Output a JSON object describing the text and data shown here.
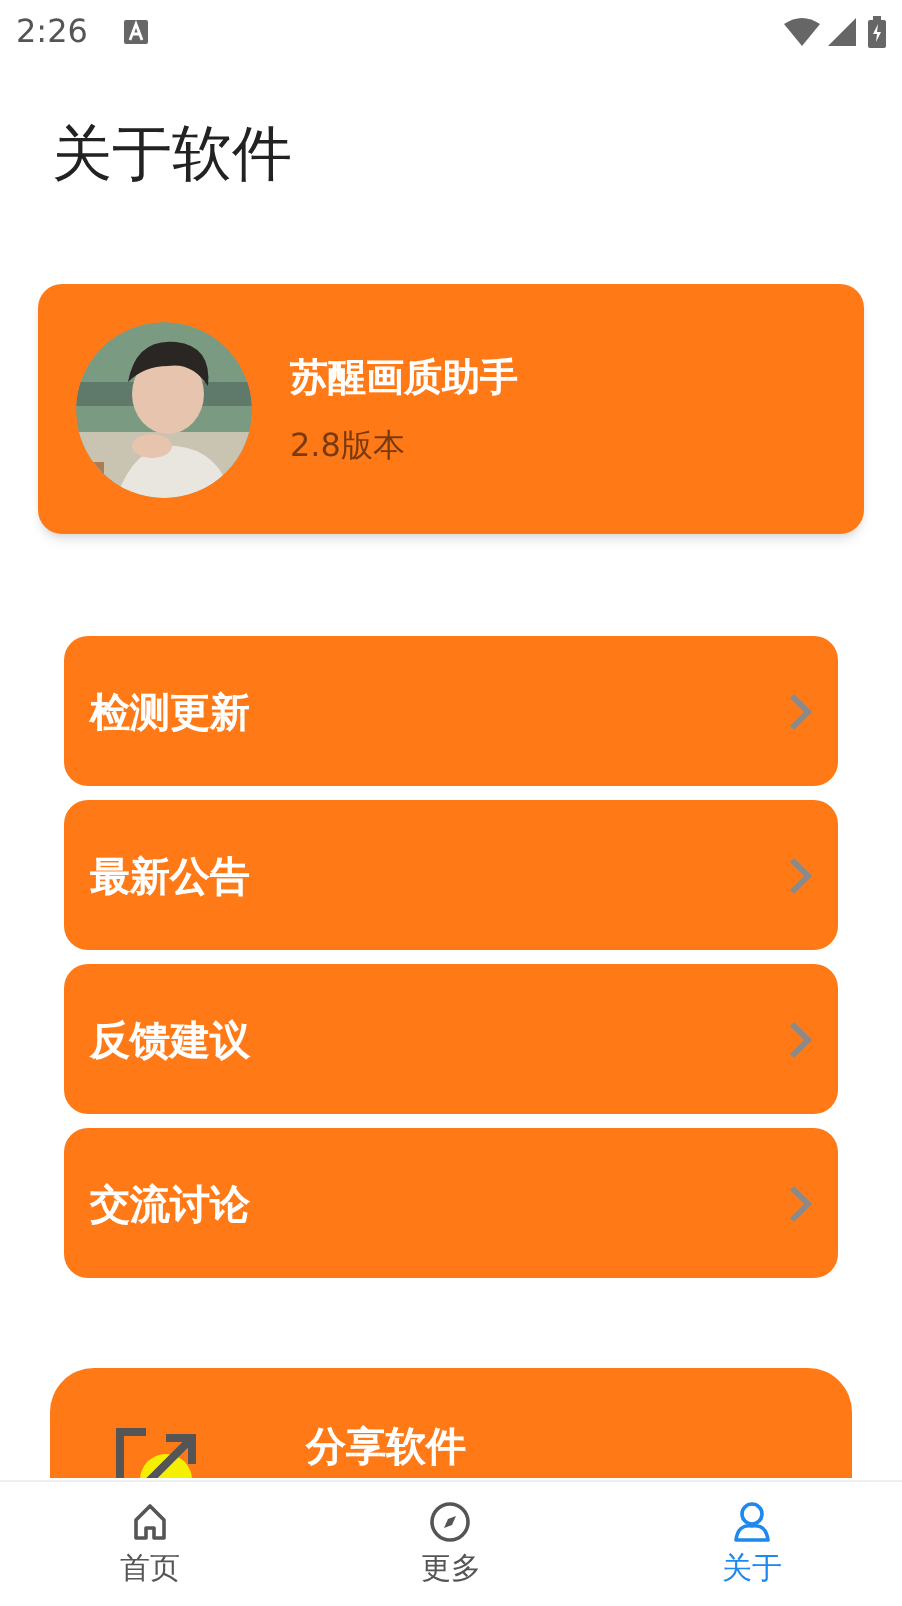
{
  "status_bar": {
    "time": "2:26"
  },
  "title": "关于软件",
  "app_card": {
    "name": "苏醒画质助手",
    "version": "2.8版本"
  },
  "menu": [
    {
      "label": "检测更新"
    },
    {
      "label": "最新公告"
    },
    {
      "label": "反馈建议"
    },
    {
      "label": "交流讨论"
    }
  ],
  "share_card": {
    "label": "分享软件"
  },
  "bottom_nav": [
    {
      "label": "首页",
      "kind": "home",
      "selected": false
    },
    {
      "label": "更多",
      "kind": "compass",
      "selected": false
    },
    {
      "label": "关于",
      "kind": "person",
      "selected": true
    }
  ]
}
